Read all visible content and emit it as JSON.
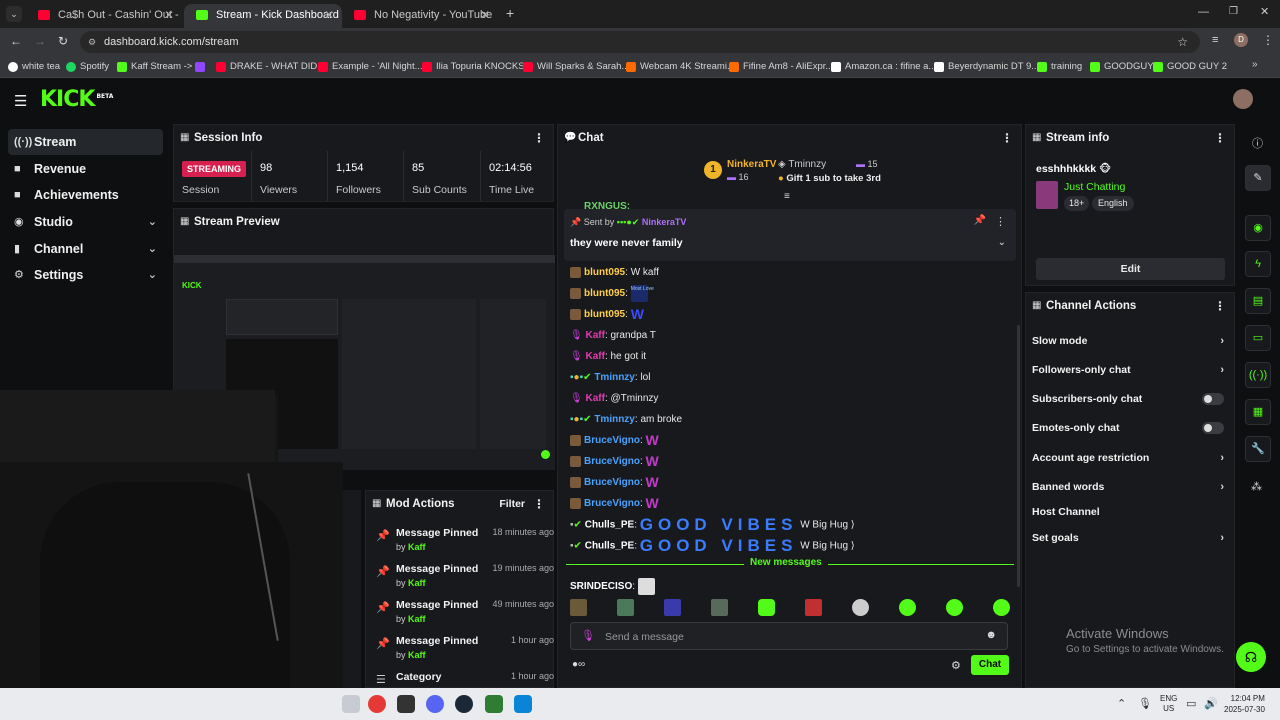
{
  "browser": {
    "tabs": [
      {
        "title": "Ca$h Out - Cashin' Out - YouTube",
        "active": false,
        "fav_color": "#ff0033"
      },
      {
        "title": "Stream - Kick Dashboard",
        "active": true,
        "fav_color": "#53fc18"
      },
      {
        "title": "No Negativity - YouTube",
        "active": false,
        "fav_color": "#ff0033"
      }
    ],
    "url": "dashboard.kick.com/stream",
    "profile_letter": "D",
    "bookmarks": [
      {
        "label": "white tea",
        "color": "#ffffff"
      },
      {
        "label": "Spotify",
        "color": "#1ed760"
      },
      {
        "label": "Kaff Stream ->",
        "color": "#53fc18"
      },
      {
        "label": "",
        "color": "#9146ff"
      },
      {
        "label": "DRAKE - WHAT DID...",
        "color": "#ff0033"
      },
      {
        "label": "Example - 'All Night...",
        "color": "#ff0033"
      },
      {
        "label": "Ilia Topuria KNOCKS...",
        "color": "#ff0033"
      },
      {
        "label": "Will Sparks & Sarah...",
        "color": "#ff0033"
      },
      {
        "label": "Webcam 4K Streami...",
        "color": "#ff6a00"
      },
      {
        "label": "Fifine Am8 - AliExpr...",
        "color": "#ff6a00"
      },
      {
        "label": "Amazon.ca : fifine a...",
        "color": "#ffffff"
      },
      {
        "label": "Beyerdynamic DT 9...",
        "color": "#ffffff"
      },
      {
        "label": "training",
        "color": "#53fc18"
      },
      {
        "label": "GOODGUY",
        "color": "#53fc18"
      },
      {
        "label": "GOOD GUY 2",
        "color": "#53fc18"
      }
    ]
  },
  "app": {
    "logo": "KICK",
    "logo_badge": "BETA",
    "sidebar": [
      {
        "label": "Stream",
        "icon": "((·))",
        "active": true,
        "expandable": false
      },
      {
        "label": "Revenue",
        "icon": "■",
        "active": false,
        "expandable": false
      },
      {
        "label": "Achievements",
        "icon": "■",
        "active": false,
        "expandable": false
      },
      {
        "label": "Studio",
        "icon": "◉",
        "active": false,
        "expandable": true
      },
      {
        "label": "Channel",
        "icon": "▮",
        "active": false,
        "expandable": true
      },
      {
        "label": "Settings",
        "icon": "⚙",
        "active": false,
        "expandable": true
      }
    ],
    "session": {
      "title": "Session Info",
      "status": "STREAMING",
      "status_label": "Session",
      "stats": [
        {
          "value": "98",
          "label": "Viewers"
        },
        {
          "value": "1,154",
          "label": "Followers"
        },
        {
          "value": "85",
          "label": "Sub Counts"
        },
        {
          "value": "02:14:56",
          "label": "Time Live"
        }
      ]
    },
    "preview": {
      "title": "Stream Preview"
    },
    "mod_actions": {
      "title": "Mod Actions",
      "filter_label": "Filter",
      "items": [
        {
          "title": "Message Pinned",
          "by_prefix": "by",
          "by": "Kaff",
          "time": "18 minutes ago"
        },
        {
          "title": "Message Pinned",
          "by_prefix": "by",
          "by": "Kaff",
          "time": "19 minutes ago"
        },
        {
          "title": "Message Pinned",
          "by_prefix": "by",
          "by": "Kaff",
          "time": "49 minutes ago"
        },
        {
          "title": "Message Pinned",
          "by_prefix": "by",
          "by": "Kaff",
          "time": "1 hour ago"
        },
        {
          "title": "Category",
          "by_prefix": "",
          "by": "",
          "time": "1 hour ago"
        }
      ]
    },
    "chat": {
      "title": "Chat",
      "gifters": {
        "top_name": "NinkeraTV",
        "top_rank": "1",
        "top_count": "16",
        "second_name": "Tminnzy",
        "second_count": "15",
        "cta": "Gift 1 sub to take 3rd"
      },
      "partial_top": "RXNGUS:",
      "pinned": {
        "sent_by_label": "Sent by",
        "sender": "NinkeraTV",
        "text": "they were never family"
      },
      "messages": [
        {
          "user": "blunt095",
          "text": "W kaff",
          "color": "#ffcf4a",
          "emote": ""
        },
        {
          "user": "blunt095",
          "text": "",
          "color": "#ffcf4a",
          "emote": "Most Love"
        },
        {
          "user": "blunt095",
          "text": "",
          "color": "#ffcf4a",
          "emote": "W"
        },
        {
          "user": "Kaff",
          "text": "grandpa T",
          "color": "#e23ab2",
          "emote": ""
        },
        {
          "user": "Kaff",
          "text": "he got it",
          "color": "#e23ab2",
          "emote": ""
        },
        {
          "user": "Tminnzy",
          "text": "lol",
          "color": "#4aa3ff",
          "emote": ""
        },
        {
          "user": "Kaff",
          "text": "@Tminnzy",
          "color": "#e23ab2",
          "emote": ""
        },
        {
          "user": "Tminnzy",
          "text": "am broke",
          "color": "#4aa3ff",
          "emote": ""
        },
        {
          "user": "BruceVigno",
          "text": "",
          "color": "#4aa3ff",
          "emote": "W"
        },
        {
          "user": "BruceVigno",
          "text": "",
          "color": "#4aa3ff",
          "emote": "W"
        },
        {
          "user": "BruceVigno",
          "text": "",
          "color": "#4aa3ff",
          "emote": "W"
        },
        {
          "user": "BruceVigno",
          "text": "",
          "color": "#4aa3ff",
          "emote": "W"
        },
        {
          "user": "Chulls_PE",
          "text": "W Big Hug",
          "color": "#ffffff",
          "emote": "GOOD VIBES"
        },
        {
          "user": "Chulls_PE",
          "text": "W Big Hug",
          "color": "#ffffff",
          "emote": "GOOD VIBES"
        }
      ],
      "new_messages_label": "New messages",
      "after_new": {
        "user": "SRINDECISO",
        "color": "#ffffff"
      },
      "input_placeholder": "Send a message",
      "send_label": "Chat",
      "infinity": "∞"
    },
    "stream_info": {
      "title": "Stream info",
      "stream_title": "esshhhkkkk",
      "category": "Just Chatting",
      "tags": [
        "18+",
        "English"
      ],
      "edit_label": "Edit"
    },
    "channel_actions": {
      "title": "Channel Actions",
      "items": [
        {
          "label": "Slow mode",
          "kind": "chevron"
        },
        {
          "label": "Followers-only chat",
          "kind": "chevron"
        },
        {
          "label": "Subscribers-only chat",
          "kind": "toggle"
        },
        {
          "label": "Emotes-only chat",
          "kind": "toggle"
        },
        {
          "label": "Account age restriction",
          "kind": "chevron"
        },
        {
          "label": "Banned words",
          "kind": "chevron"
        },
        {
          "label": "Host Channel",
          "kind": "none"
        },
        {
          "label": "Set goals",
          "kind": "chevron"
        }
      ]
    },
    "watermark": {
      "title": "Activate Windows",
      "subtitle": "Go to Settings to activate Windows."
    }
  },
  "taskbar": {
    "lang": "ENG",
    "region": "US",
    "time": "12:04 PM",
    "date": "2025-07-30"
  }
}
